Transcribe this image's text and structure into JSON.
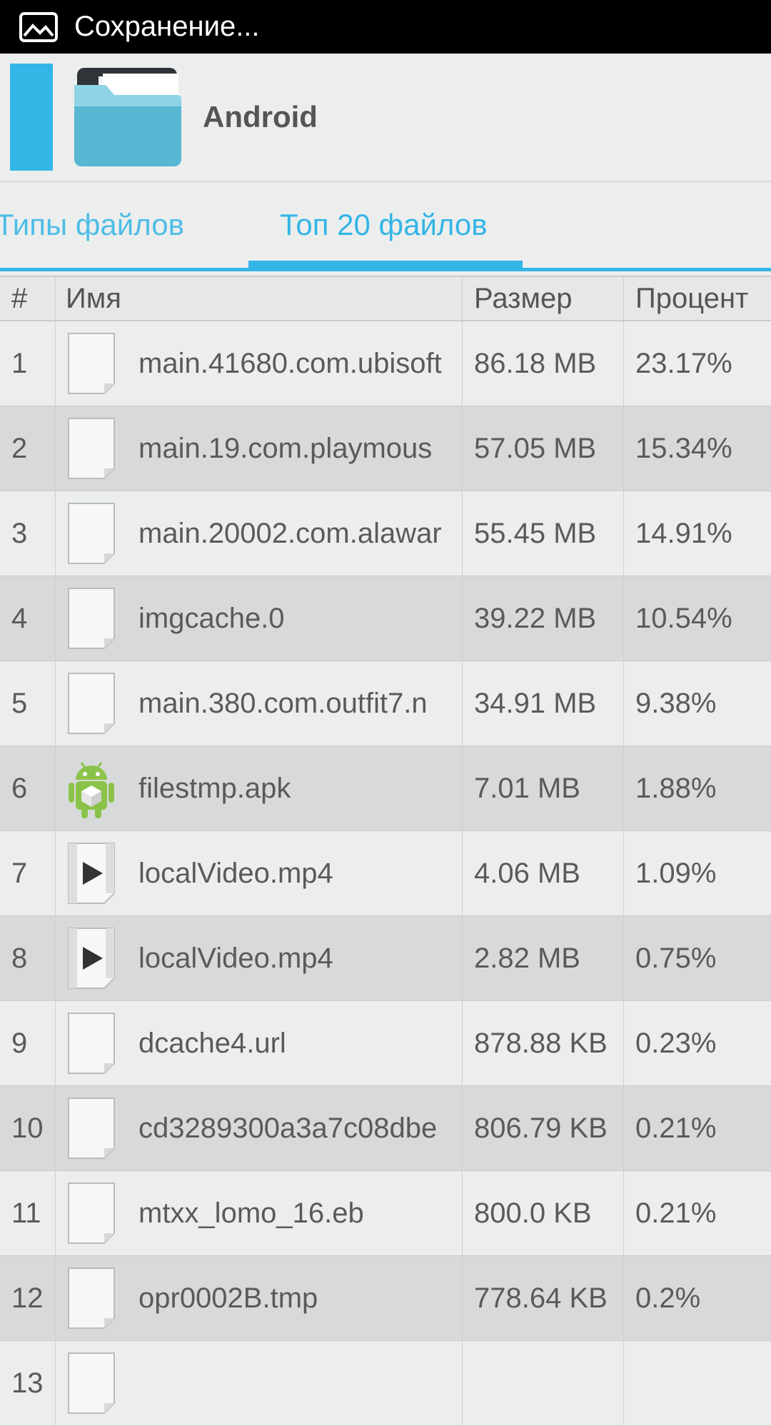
{
  "status_bar": {
    "text": "Сохранение..."
  },
  "header": {
    "title": "Android"
  },
  "tabs": [
    {
      "label": "Типы файлов"
    },
    {
      "label": "Топ 20 файлов"
    }
  ],
  "table": {
    "headers": {
      "num": "#",
      "name": "Имя",
      "size": "Размер",
      "percent": "Процент"
    },
    "rows": [
      {
        "num": "1",
        "icon": "blank-file-icon",
        "name": "main.41680.com.ubisoft",
        "size": "86.18 MB",
        "percent": "23.17%"
      },
      {
        "num": "2",
        "icon": "blank-file-icon",
        "name": "main.19.com.playmous",
        "size": "57.05 MB",
        "percent": "15.34%"
      },
      {
        "num": "3",
        "icon": "blank-file-icon",
        "name": "main.20002.com.alawar",
        "size": "55.45 MB",
        "percent": "14.91%"
      },
      {
        "num": "4",
        "icon": "blank-file-icon",
        "name": "imgcache.0",
        "size": "39.22 MB",
        "percent": "10.54%"
      },
      {
        "num": "5",
        "icon": "blank-file-icon",
        "name": "main.380.com.outfit7.n",
        "size": "34.91 MB",
        "percent": "9.38%"
      },
      {
        "num": "6",
        "icon": "android-apk-icon",
        "name": "filestmp.apk",
        "size": "7.01 MB",
        "percent": "1.88%"
      },
      {
        "num": "7",
        "icon": "video-file-icon",
        "name": "localVideo.mp4",
        "size": "4.06 MB",
        "percent": "1.09%"
      },
      {
        "num": "8",
        "icon": "video-file-icon",
        "name": "localVideo.mp4",
        "size": "2.82 MB",
        "percent": "0.75%"
      },
      {
        "num": "9",
        "icon": "blank-file-icon",
        "name": "dcache4.url",
        "size": "878.88 KB",
        "percent": "0.23%"
      },
      {
        "num": "10",
        "icon": "blank-file-icon",
        "name": "cd3289300a3a7c08dbe",
        "size": "806.79 KB",
        "percent": "0.21%"
      },
      {
        "num": "11",
        "icon": "blank-file-icon",
        "name": "mtxx_lomo_16.eb",
        "size": "800.0 KB",
        "percent": "0.21%"
      },
      {
        "num": "12",
        "icon": "blank-file-icon",
        "name": "opr0002B.tmp",
        "size": "778.64 KB",
        "percent": "0.2%"
      },
      {
        "num": "13",
        "icon": "blank-file-icon",
        "name": "",
        "size": "",
        "percent": ""
      }
    ]
  },
  "colors": {
    "accent": "#33b5e5",
    "status_bar": "#000000"
  }
}
